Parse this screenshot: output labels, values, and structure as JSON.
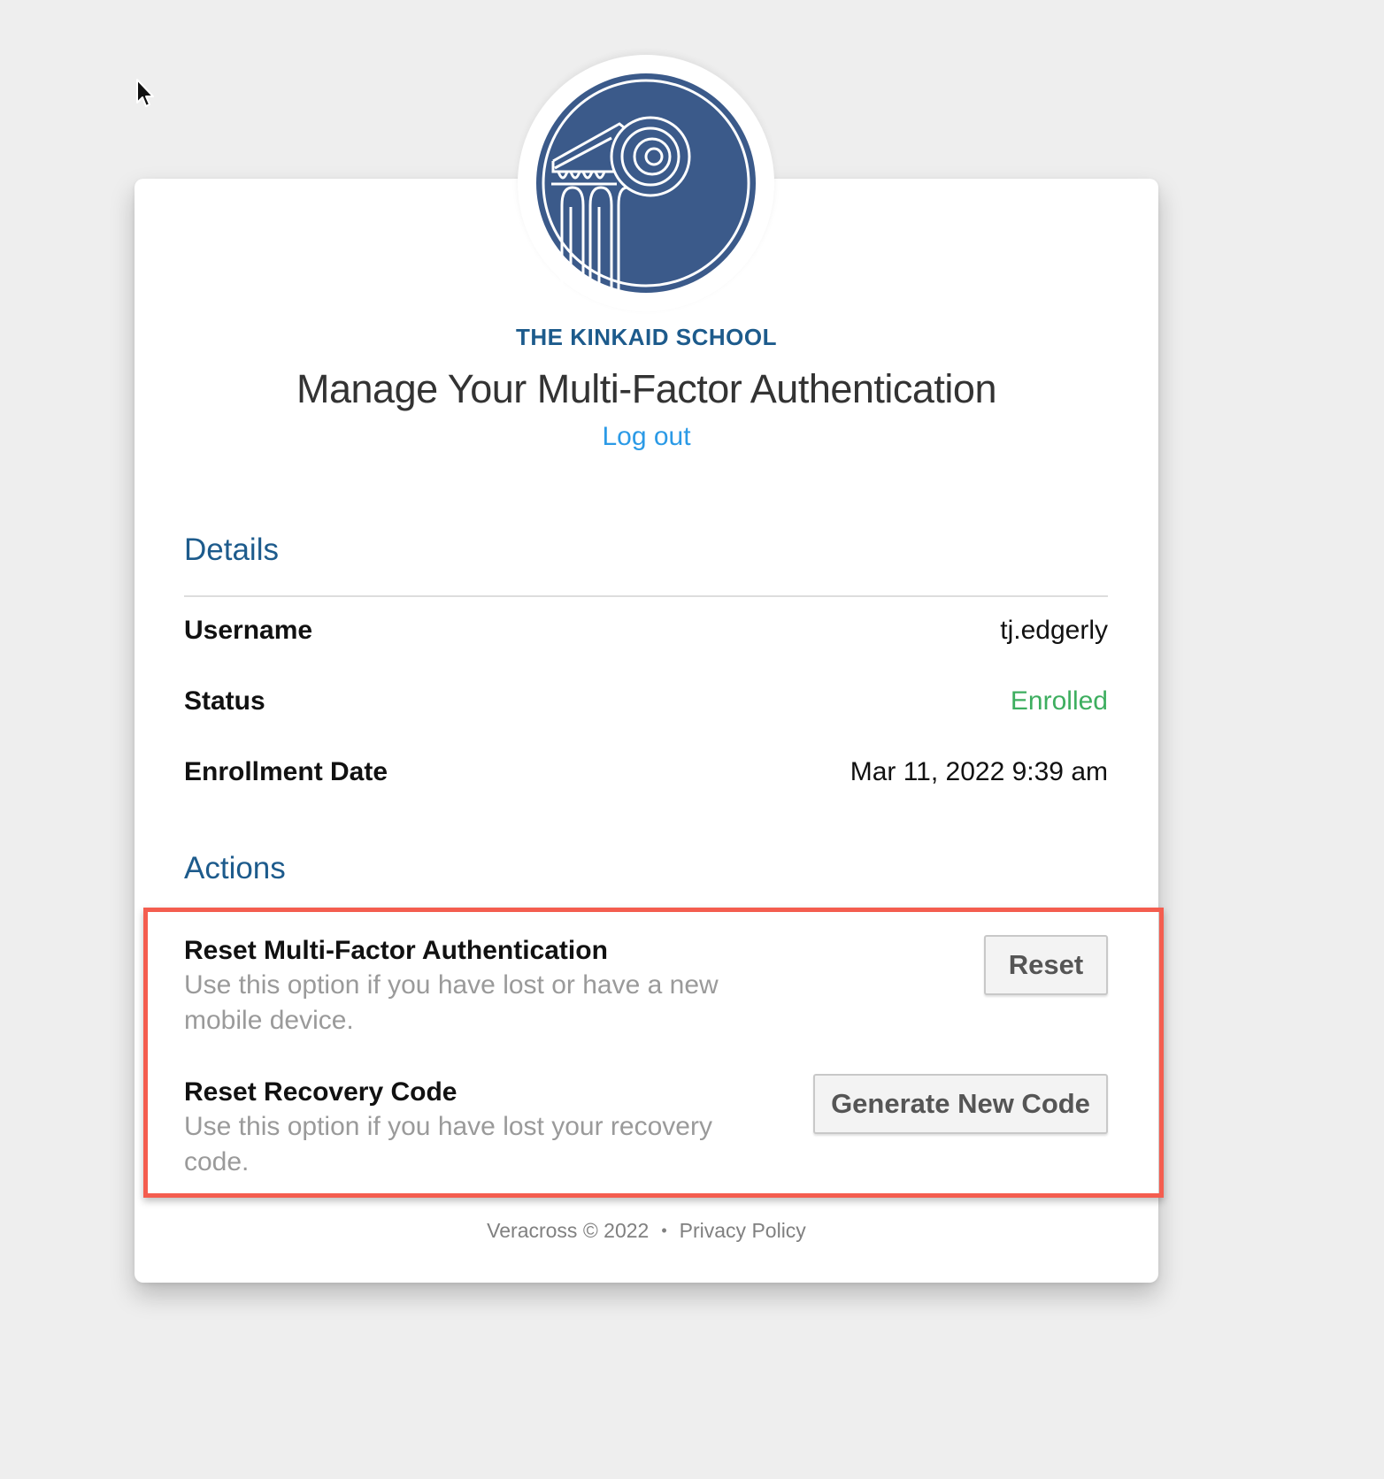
{
  "school": {
    "name": "THE KINKAID SCHOOL",
    "logo": "ionic-column-logo",
    "logo_color": "#3b5a8a"
  },
  "header": {
    "title": "Manage Your Multi-Factor Authentication",
    "logout_label": "Log out"
  },
  "details": {
    "heading": "Details",
    "username_label": "Username",
    "username_value": "tj.edgerly",
    "status_label": "Status",
    "status_value": "Enrolled",
    "status_color": "#3dae5f",
    "enrollment_label": "Enrollment Date",
    "enrollment_value": "Mar 11, 2022 9:39 am"
  },
  "actions": {
    "heading": "Actions",
    "mfa_title": "Reset Multi-Factor Authentication",
    "mfa_desc": "Use this option if you have lost or have a new mobile device.",
    "mfa_button": "Reset",
    "recovery_title": "Reset Recovery Code",
    "recovery_desc": "Use this option if you have lost your recovery code.",
    "recovery_button": "Generate New Code",
    "highlight_color": "#f45d4f"
  },
  "footer": {
    "copyright": "Veracross © 2022",
    "separator": "•",
    "privacy_label": "Privacy Policy"
  },
  "colors": {
    "accent": "#1d5b8c",
    "link": "#2b9ae6",
    "background": "#eeeeee"
  }
}
